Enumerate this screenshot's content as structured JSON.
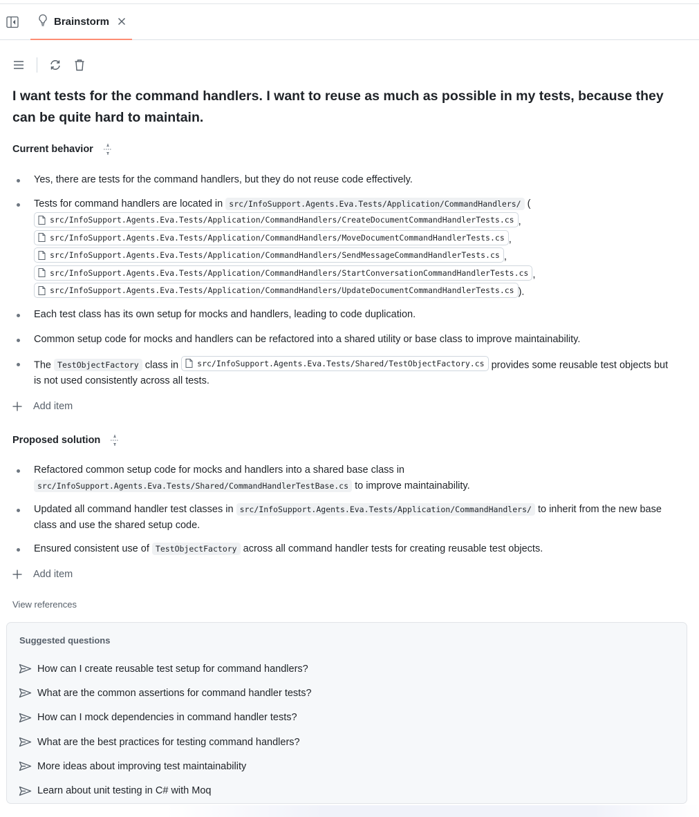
{
  "tabs": [
    {
      "label": "Brainstorm",
      "icon": "lightbulb-icon",
      "active": true
    }
  ],
  "toolbar": {
    "menu_icon": "hamburger-menu-icon",
    "refresh_icon": "refresh-icon",
    "delete_icon": "trash-icon"
  },
  "prompt": "I want tests for the command handlers. I want to reuse as much as possible in my tests, because they can be quite hard to maintain.",
  "current_behavior": {
    "title": "Current behavior",
    "items": [
      {
        "text": "Yes, there are tests for the command handlers, but they do not reuse code effectively."
      },
      {
        "prefix": "Tests for command handlers are located in",
        "dir": "src/InfoSupport.Agents.Eva.Tests/Application/CommandHandlers/",
        "open_paren": "(",
        "files": [
          "src/InfoSupport.Agents.Eva.Tests/Application/CommandHandlers/CreateDocumentCommandHandlerTests.cs",
          "src/InfoSupport.Agents.Eva.Tests/Application/CommandHandlers/MoveDocumentCommandHandlerTests.cs",
          "src/InfoSupport.Agents.Eva.Tests/Application/CommandHandlers/SendMessageCommandHandlerTests.cs",
          "src/InfoSupport.Agents.Eva.Tests/Application/CommandHandlers/StartConversationCommandHandlerTests.cs",
          "src/InfoSupport.Agents.Eva.Tests/Application/CommandHandlers/UpdateDocumentCommandHandlerTests.cs"
        ],
        "separator": ",",
        "close": ")."
      },
      {
        "text": "Each test class has its own setup for mocks and handlers, leading to code duplication."
      },
      {
        "text": "Common setup code for mocks and handlers can be refactored into a shared utility or base class to improve maintainability."
      },
      {
        "prefix": "The",
        "code": "TestObjectFactory",
        "middle": "class in",
        "file": "src/InfoSupport.Agents.Eva.Tests/Shared/TestObjectFactory.cs",
        "suffix": "provides some reusable test objects but is not used consistently across all tests."
      }
    ],
    "add_item_label": "Add item"
  },
  "proposed_solution": {
    "title": "Proposed solution",
    "items": [
      {
        "prefix": "Refactored common setup code for mocks and handlers into a shared base class in",
        "code": "src/InfoSupport.Agents.Eva.Tests/Shared/CommandHandlerTestBase.cs",
        "suffix": "to improve maintainability."
      },
      {
        "prefix": "Updated all command handler test classes in",
        "code": "src/InfoSupport.Agents.Eva.Tests/Application/CommandHandlers/",
        "suffix": "to inherit from the new base class and use the shared setup code."
      },
      {
        "prefix": "Ensured consistent use of",
        "code": "TestObjectFactory",
        "suffix": "across all command handler tests for creating reusable test objects."
      }
    ],
    "add_item_label": "Add item"
  },
  "view_references_label": "View references",
  "suggested_questions": {
    "title": "Suggested questions",
    "items": [
      "How can I create reusable test setup for command handlers?",
      "What are the common assertions for command handler tests?",
      "How can I mock dependencies in command handler tests?",
      "What are the best practices for testing command handlers?",
      "More ideas about improving test maintainability",
      "Learn about unit testing in C# with Moq"
    ]
  },
  "colors": {
    "active_tab_underline": "#fd8c73",
    "text": "#1f2328",
    "muted": "#57606a",
    "panel_bg": "#f6f8fa"
  }
}
